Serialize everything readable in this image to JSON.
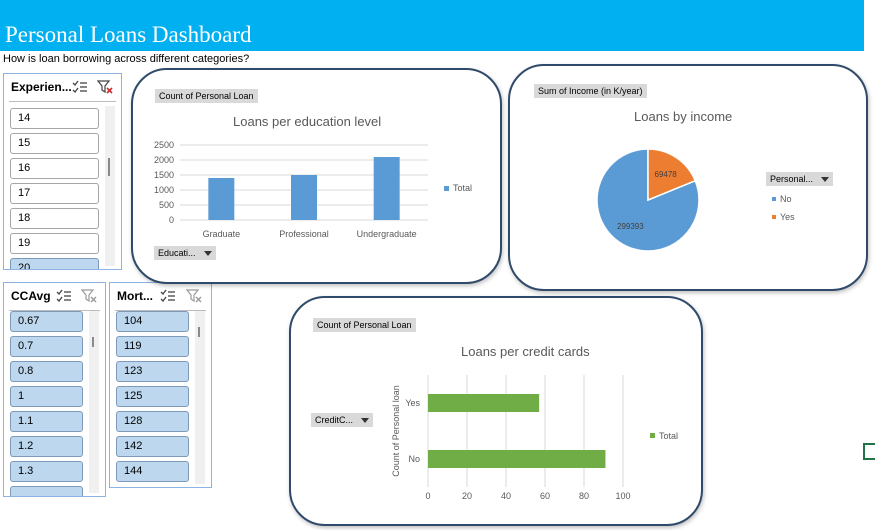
{
  "dashboard": {
    "title": "Personal Loans Dashboard",
    "subtitle": "How is loan borrowing across different categories?"
  },
  "slicers": {
    "experience": {
      "title": "Experien...",
      "items": [
        "14",
        "15",
        "16",
        "17",
        "18",
        "19",
        "20"
      ],
      "selected": [
        false,
        false,
        false,
        false,
        false,
        false,
        true
      ]
    },
    "ccavg": {
      "title": "CCAvg",
      "items": [
        "0.67",
        "0.7",
        "0.8",
        "1",
        "1.1",
        "1.2",
        "1.3",
        ""
      ],
      "selected": [
        true,
        true,
        true,
        true,
        true,
        true,
        true,
        true
      ]
    },
    "mortgage": {
      "title": "Mort...",
      "items": [
        "104",
        "119",
        "123",
        "125",
        "128",
        "142",
        "144"
      ],
      "selected": [
        true,
        true,
        true,
        true,
        true,
        true,
        true
      ]
    }
  },
  "education_chart": {
    "field_button": "Count of Personal Loan",
    "axis_field": "Educati...",
    "legend": "Total",
    "colors": {
      "bar": "#5b9bd5"
    }
  },
  "income_chart": {
    "field_button": "Sum of Income (in K/year)",
    "legend_field": "Personal...",
    "legend_items": [
      "No",
      "Yes"
    ],
    "colors": {
      "No": "#5b9bd5",
      "Yes": "#ed7d31"
    }
  },
  "credit_chart": {
    "field_button": "Count of Personal Loan",
    "axis_field": "CreditC...",
    "legend": "Total",
    "colors": {
      "bar": "#70ad47"
    }
  },
  "chart_data": [
    {
      "type": "bar",
      "title": "Loans per education level",
      "categories": [
        "Graduate",
        "Professional",
        "Undergraduate"
      ],
      "series": [
        {
          "name": "Total",
          "values": [
            1400,
            1500,
            2100
          ]
        }
      ],
      "ylim": [
        0,
        2500
      ],
      "yticks": [
        0,
        500,
        1000,
        1500,
        2000,
        2500
      ],
      "grid": true,
      "legend": "right"
    },
    {
      "type": "pie",
      "title": "Loans by income",
      "labels": [
        "No",
        "Yes"
      ],
      "values": [
        299393,
        69478
      ],
      "legend": "right"
    },
    {
      "type": "bar",
      "orientation": "horizontal",
      "title": "Loans per credit cards",
      "categories": [
        "No",
        "Yes"
      ],
      "series": [
        {
          "name": "Total",
          "values": [
            91,
            57
          ]
        }
      ],
      "xlim": [
        0,
        100
      ],
      "xticks": [
        0,
        20,
        40,
        60,
        80,
        100
      ],
      "ylabel": "Count of Personal loan",
      "grid": true,
      "legend": "right"
    }
  ]
}
